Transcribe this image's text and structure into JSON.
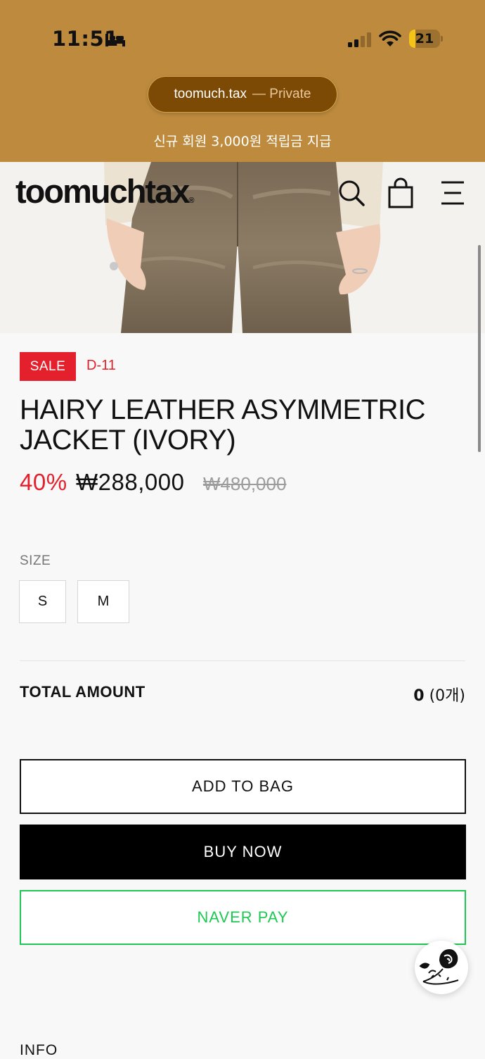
{
  "status_bar": {
    "time": "11:51",
    "battery_level": "21",
    "battery_fraction": 0.21
  },
  "browser": {
    "url": "toomuch.tax",
    "mode": "— Private"
  },
  "promo": {
    "text": "신규 회원 3,000원 적립금 지급"
  },
  "header": {
    "logo": "toomuchtax",
    "logo_mark": "®"
  },
  "product": {
    "sale_badge": "SALE",
    "dday": "D-11",
    "title": "HAIRY LEATHER ASYMMETRIC JACKET (IVORY)",
    "discount": "40%",
    "price": "₩288,000",
    "original_price": "₩480,000"
  },
  "size": {
    "label": "SIZE",
    "options": [
      "S",
      "M"
    ]
  },
  "total": {
    "label": "TOTAL AMOUNT",
    "value": "0",
    "count": "(0개)"
  },
  "buttons": {
    "add_to_bag": "ADD TO BAG",
    "buy_now": "BUY NOW",
    "naver_pay": "NAVER PAY"
  },
  "info": {
    "label": "INFO"
  },
  "colors": {
    "chrome_bg": "#be8b3e",
    "sale_red": "#e3202c",
    "naver_green": "#1ec853"
  }
}
